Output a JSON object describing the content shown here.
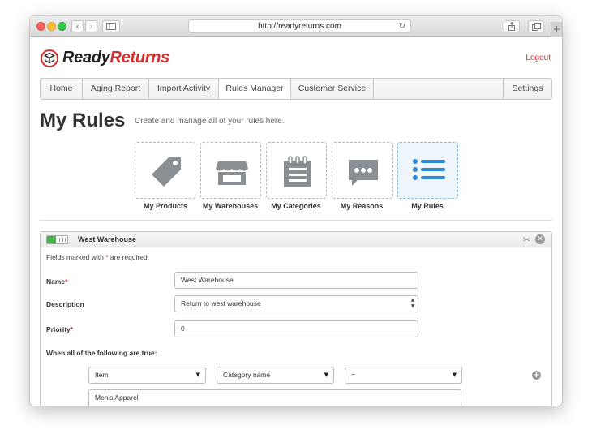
{
  "browser": {
    "url": "http://readyreturns.com"
  },
  "header": {
    "logo_brand_a": "Ready",
    "logo_brand_b": "Returns",
    "logout_label": "Logout",
    "brand_color": "#d32f2f"
  },
  "nav": {
    "tabs": [
      {
        "label": "Home"
      },
      {
        "label": "Aging Report"
      },
      {
        "label": "Import Activity"
      },
      {
        "label": "Rules Manager",
        "active": true
      },
      {
        "label": "Customer Service"
      }
    ],
    "settings_label": "Settings"
  },
  "page": {
    "title": "My Rules",
    "subtitle": "Create and manage all of your rules here."
  },
  "tiles": [
    {
      "label": "My Products",
      "icon": "tag-icon"
    },
    {
      "label": "My Warehouses",
      "icon": "storefront-icon"
    },
    {
      "label": "My Categories",
      "icon": "notepad-icon"
    },
    {
      "label": "My Reasons",
      "icon": "chat-bubble-icon"
    },
    {
      "label": "My Rules",
      "icon": "list-icon",
      "active": true
    }
  ],
  "rule_panel": {
    "title": "West Warehouse",
    "enabled": true,
    "required_note_before": "Fields marked with",
    "required_note_after": "are required.",
    "required_mark": "*",
    "name_label": "Name",
    "name_value": "West Warehouse",
    "description_label": "Description",
    "description_value": "Return to west warehouse",
    "priority_label": "Priority",
    "priority_value": "0",
    "conditions_label": "When all of the following are true:",
    "condition": {
      "field": "Item",
      "attribute": "Category name",
      "operator": "=",
      "value": "Men's Apparel"
    }
  }
}
